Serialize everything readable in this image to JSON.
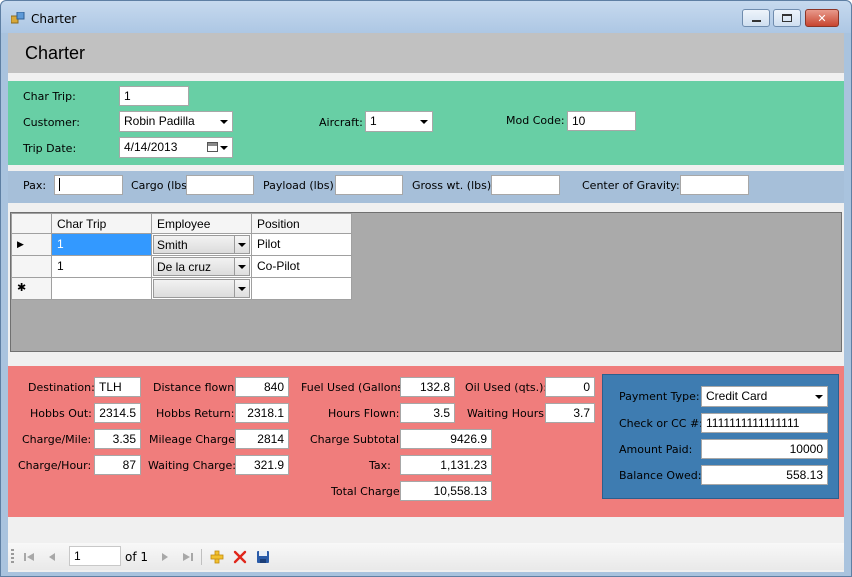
{
  "window": {
    "title": "Charter",
    "minimize_glyph": "‒",
    "maximize_glyph": "□",
    "close_glyph": "✕"
  },
  "header": {
    "title": "Charter"
  },
  "trip": {
    "char_trip_label": "Char Trip:",
    "char_trip_value": "1",
    "customer_label": "Customer:",
    "customer_value": "Robin Padilla",
    "aircraft_label": "Aircraft:",
    "aircraft_value": "1",
    "mod_code_label": "Mod Code:",
    "mod_code_value": "10",
    "trip_date_label": "Trip Date:",
    "trip_date_value": "4/14/2013"
  },
  "weights": {
    "pax_label": "Pax:",
    "pax_value": "",
    "cargo_label": "Cargo (lbs):",
    "cargo_value": "",
    "payload_label": "Payload (lbs):",
    "payload_value": "",
    "gross_label": "Gross wt. (lbs):",
    "gross_value": "",
    "cog_label": "Center of Gravity:",
    "cog_value": ""
  },
  "crew_grid": {
    "columns": [
      "Char Trip",
      "Employee",
      "Position"
    ],
    "rows": [
      {
        "char_trip": "1",
        "employee": "Smith",
        "position": "Pilot",
        "indicator": "▶"
      },
      {
        "char_trip": "1",
        "employee": "De la cruz",
        "position": "Co-Pilot",
        "indicator": ""
      },
      {
        "char_trip": "",
        "employee": "",
        "position": "",
        "indicator": "✱"
      }
    ]
  },
  "costs": {
    "destination_label": "Destination:",
    "destination_value": "TLH",
    "hobbs_out_label": "Hobbs Out:",
    "hobbs_out_value": "2314.5",
    "charge_mile_label": "Charge/Mile:",
    "charge_mile_value": "3.35",
    "charge_hour_label": "Charge/Hour:",
    "charge_hour_value": "87",
    "distance_label": "Distance flown:",
    "distance_value": "840",
    "hobbs_return_label": "Hobbs Return:",
    "hobbs_return_value": "2318.1",
    "mileage_charge_label": "Mileage Charge:",
    "mileage_charge_value": "2814",
    "waiting_charge_label": "Waiting Charge:",
    "waiting_charge_value": "321.9",
    "fuel_label": "Fuel Used (Gallons):",
    "fuel_value": "132.8",
    "hours_flown_label": "Hours Flown:",
    "hours_flown_value": "3.5",
    "charge_subtotal_label": "Charge Subtotal:",
    "charge_subtotal_value": "9426.9",
    "tax_label": "Tax:",
    "tax_value": "1,131.23",
    "total_label": "Total Charge:",
    "total_value": "10,558.13",
    "oil_label": "Oil Used (qts.):",
    "oil_value": "0",
    "waiting_hours_label": "Waiting Hours:",
    "waiting_hours_value": "3.7"
  },
  "payment": {
    "type_label": "Payment Type:",
    "type_value": "Credit Card",
    "check_label": "Check or CC #:",
    "check_value": "1111111111111111",
    "paid_label": "Amount Paid:",
    "paid_value": "10000",
    "balance_label": "Balance Owed:",
    "balance_value": "558.13"
  },
  "navigator": {
    "position": "1",
    "count_text": "of 1"
  }
}
